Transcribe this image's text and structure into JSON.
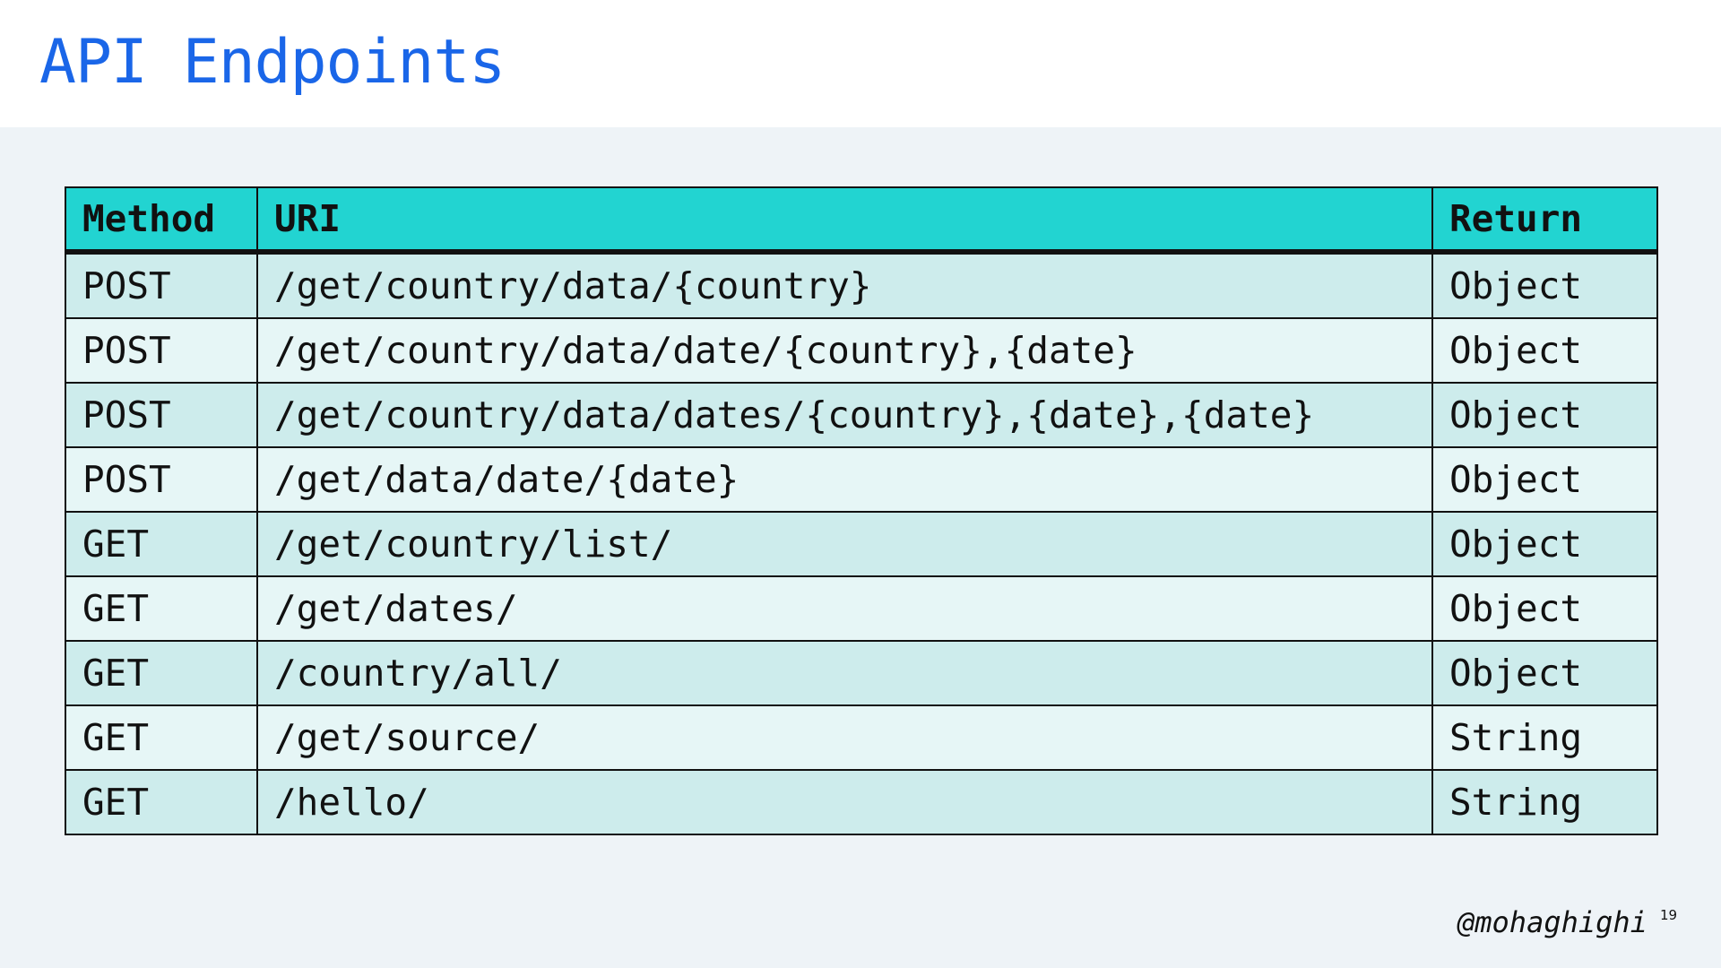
{
  "slide": {
    "title": "API Endpoints",
    "footer_handle": "@mohaghighi",
    "page_number": "19",
    "colors": {
      "title": "#1a66e8",
      "header_bg": "#22d4d1",
      "row_odd": "#cdecec",
      "row_even": "#e6f6f6",
      "content_bg": "#eef3f7"
    }
  },
  "table": {
    "headers": [
      "Method",
      "URI",
      "Return"
    ],
    "rows": [
      [
        "POST",
        "/get/country/data/{country}",
        "Object"
      ],
      [
        "POST",
        "/get/country/data/date/{country},{date}",
        "Object"
      ],
      [
        "POST",
        "/get/country/data/dates/{country},{date},{date}",
        "Object"
      ],
      [
        "POST",
        "/get/data/date/{date}",
        "Object"
      ],
      [
        "GET",
        "/get/country/list/",
        "Object"
      ],
      [
        "GET",
        "/get/dates/",
        "Object"
      ],
      [
        "GET",
        "/country/all/",
        "Object"
      ],
      [
        "GET",
        "/get/source/",
        "String"
      ],
      [
        "GET",
        "/hello/",
        "String"
      ]
    ]
  }
}
